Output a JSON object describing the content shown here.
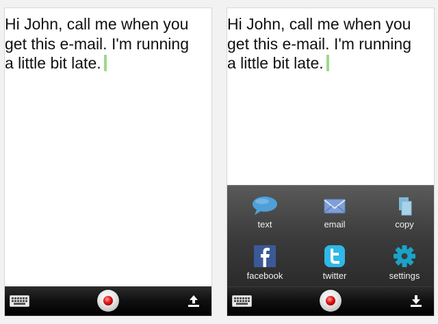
{
  "screens": [
    {
      "lines": [
        "Hi John, call me when you",
        "get this e-mail. I'm running",
        "a little bit late."
      ],
      "toolbar": {
        "keyboard_icon": "keyboard-icon",
        "record_icon": "record-icon",
        "right_icon": "upload-icon"
      }
    },
    {
      "lines": [
        "Hi John, call me when you",
        "get this e-mail. I'm running",
        "a little bit late."
      ],
      "toolbar": {
        "keyboard_icon": "keyboard-icon",
        "record_icon": "record-icon",
        "right_icon": "download-icon"
      },
      "share_options": [
        {
          "label": "text",
          "icon": "speech-bubble-icon"
        },
        {
          "label": "email",
          "icon": "envelope-icon"
        },
        {
          "label": "copy",
          "icon": "copy-icon"
        },
        {
          "label": "facebook",
          "icon": "facebook-icon"
        },
        {
          "label": "twitter",
          "icon": "twitter-icon"
        },
        {
          "label": "settings",
          "icon": "gear-icon"
        }
      ]
    }
  ],
  "colors": {
    "cursor": "#9fd88a",
    "record_red": "#e01010",
    "text_bubble_blue": "#4f9fd8",
    "email_blue": "#7f9fd8",
    "copy_blue": "#7fb8d8",
    "facebook_blue": "#3b5998",
    "twitter_blue": "#2fb8e8",
    "settings_teal": "#1aa3c8"
  }
}
